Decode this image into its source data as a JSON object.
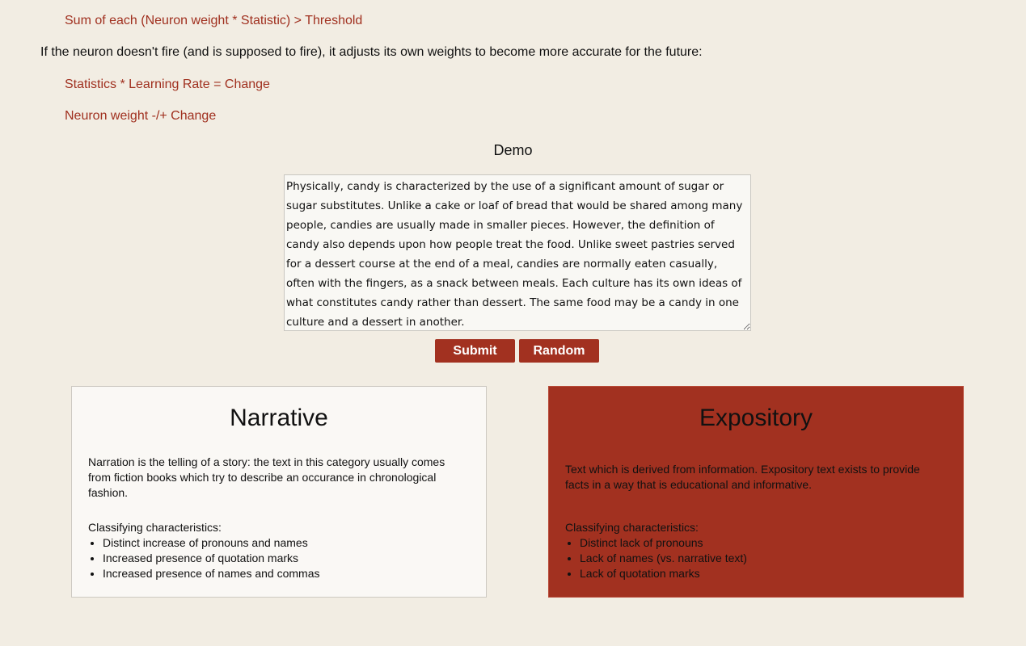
{
  "formulas": {
    "threshold": "Sum of each (Neuron weight * Statistic) > Threshold",
    "change": "Statistics * Learning Rate = Change",
    "weight": "Neuron weight -/+ Change"
  },
  "intro": "If the neuron doesn't fire (and is supposed to fire), it adjusts its own weights to become more accurate for the future:",
  "demo": {
    "title": "Demo",
    "text": "Physically, candy is characterized by the use of a significant amount of sugar or sugar substitutes. Unlike a cake or loaf of bread that would be shared among many people, candies are usually made in smaller pieces. However, the definition of candy also depends upon how people treat the food. Unlike sweet pastries served for a dessert course at the end of a meal, candies are normally eaten casually, often with the fingers, as a snack between meals. Each culture has its own ideas of what constitutes candy rather than dessert. The same food may be a candy in one culture and a dessert in another.",
    "submit_label": "Submit",
    "random_label": "Random"
  },
  "narrative": {
    "title": "Narrative",
    "description": "Narration is the telling of a story: the text in this category usually comes from fiction books which try to describe an occurance in chronological fashion.",
    "characteristics_label": "Classifying characteristics:",
    "characteristics": [
      "Distinct increase of pronouns and names",
      "Increased presence of quotation marks",
      "Increased presence of names and commas"
    ]
  },
  "expository": {
    "title": "Expository",
    "description": "Text which is derived from information. Expository text exists to provide facts in a way that is educational and informative.",
    "characteristics_label": "Classifying characteristics:",
    "characteristics": [
      "Distinct lack of pronouns",
      "Lack of names (vs. narrative text)",
      "Lack of quotation marks"
    ]
  },
  "colors": {
    "accent": "#a23120",
    "background": "#f2ede3",
    "card_light": "#faf8f5"
  }
}
